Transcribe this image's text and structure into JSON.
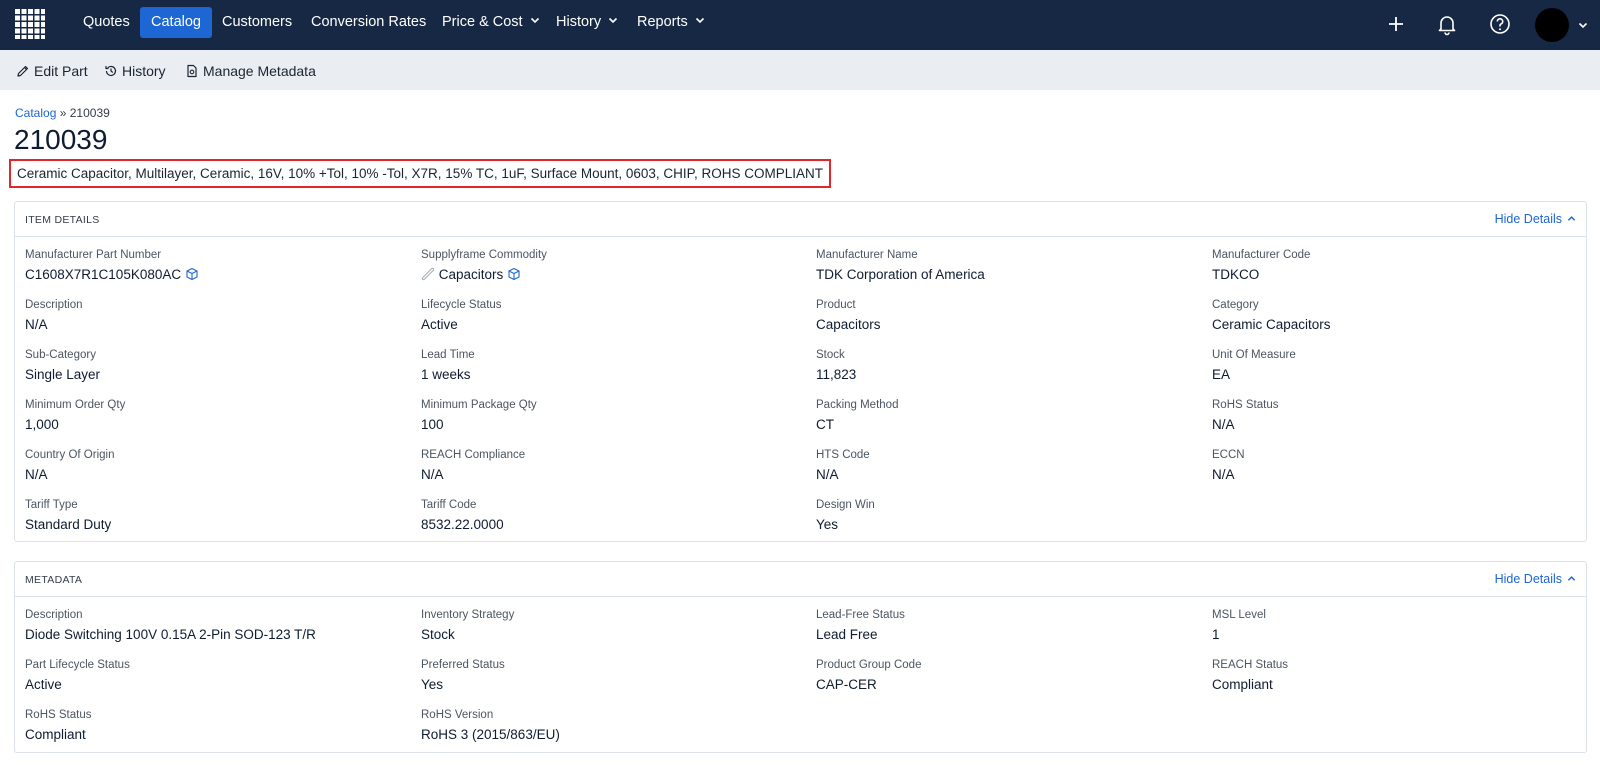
{
  "nav": {
    "items": [
      {
        "label": "Quotes",
        "has_dropdown": false,
        "active": false
      },
      {
        "label": "Catalog",
        "has_dropdown": false,
        "active": true
      },
      {
        "label": "Customers",
        "has_dropdown": false,
        "active": false
      },
      {
        "label": "Conversion Rates",
        "has_dropdown": false,
        "active": false
      },
      {
        "label": "Price & Cost",
        "has_dropdown": true,
        "active": false
      },
      {
        "label": "History",
        "has_dropdown": true,
        "active": false
      },
      {
        "label": "Reports",
        "has_dropdown": true,
        "active": false
      }
    ],
    "icons": [
      "plus-icon",
      "bell-icon",
      "help-icon"
    ],
    "colors": {
      "bar": "#172844",
      "active": "#1d66d4"
    }
  },
  "toolbar": {
    "edit_label": "Edit Part",
    "history_label": "History",
    "metadata_label": "Manage Metadata"
  },
  "breadcrumb": {
    "root": "Catalog",
    "separator": "»",
    "current": "210039"
  },
  "part": {
    "number": "210039",
    "description": "Ceramic Capacitor, Multilayer, Ceramic, 16V, 10% +Tol, 10% -Tol, X7R, 15% TC, 1uF, Surface Mount, 0603, CHIP, ROHS COMPLIANT"
  },
  "item_details": {
    "title": "ITEM DETAILS",
    "toggle_label": "Hide Details",
    "fields": [
      {
        "label": "Manufacturer Part Number",
        "value": "C1608X7R1C105K080AC"
      },
      {
        "label": "Supplyframe Commodity",
        "value": "Capacitors"
      },
      {
        "label": "Manufacturer Name",
        "value": "TDK Corporation of America"
      },
      {
        "label": "Manufacturer Code",
        "value": "TDKCO"
      },
      {
        "label": "Description",
        "value": "N/A"
      },
      {
        "label": "Lifecycle Status",
        "value": "Active"
      },
      {
        "label": "Product",
        "value": "Capacitors"
      },
      {
        "label": "Category",
        "value": "Ceramic Capacitors"
      },
      {
        "label": "Sub-Category",
        "value": "Single Layer"
      },
      {
        "label": "Lead Time",
        "value": "1 weeks"
      },
      {
        "label": "Stock",
        "value": "11,823"
      },
      {
        "label": "Unit Of Measure",
        "value": "EA"
      },
      {
        "label": "Minimum Order Qty",
        "value": "1,000"
      },
      {
        "label": "Minimum Package Qty",
        "value": "100"
      },
      {
        "label": "Packing Method",
        "value": "CT"
      },
      {
        "label": "RoHS Status",
        "value": "N/A"
      },
      {
        "label": "Country Of Origin",
        "value": "N/A"
      },
      {
        "label": "REACH Compliance",
        "value": "N/A"
      },
      {
        "label": "HTS Code",
        "value": "N/A"
      },
      {
        "label": "ECCN",
        "value": "N/A"
      },
      {
        "label": "Tariff Type",
        "value": "Standard Duty"
      },
      {
        "label": "Tariff Code",
        "value": "8532.22.0000"
      },
      {
        "label": "Design Win",
        "value": "Yes"
      }
    ]
  },
  "metadata": {
    "title": "METADATA",
    "toggle_label": "Hide Details",
    "fields": [
      {
        "label": "Description",
        "value": "Diode Switching 100V 0.15A 2-Pin SOD-123 T/R"
      },
      {
        "label": "Inventory Strategy",
        "value": "Stock"
      },
      {
        "label": "Lead-Free Status",
        "value": "Lead Free"
      },
      {
        "label": "MSL Level",
        "value": "1"
      },
      {
        "label": "Part Lifecycle Status",
        "value": "Active"
      },
      {
        "label": "Preferred Status",
        "value": "Yes"
      },
      {
        "label": "Product Group Code",
        "value": "CAP-CER"
      },
      {
        "label": "REACH Status",
        "value": "Compliant"
      },
      {
        "label": "RoHS Status",
        "value": "Compliant"
      },
      {
        "label": "RoHS Version",
        "value": "RoHS 3 (2015/863/EU)"
      }
    ]
  }
}
